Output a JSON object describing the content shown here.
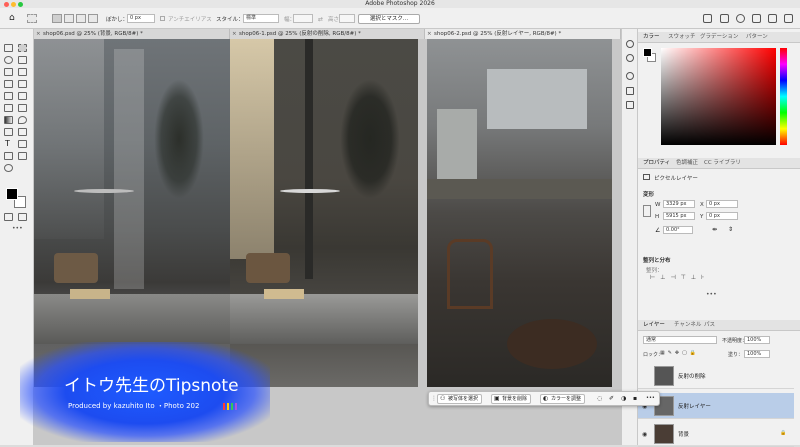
{
  "app": {
    "title": "Adobe Photoshop 2026"
  },
  "options": {
    "feather_label": "ぼかし：",
    "feather_value": "0 px",
    "antialias_label": "アンチエイリアス",
    "style_label": "スタイル：",
    "style_value": "標準",
    "width_label": "幅：",
    "height_label": "高さ：",
    "mask_button": "選択とマスク..."
  },
  "documents": [
    {
      "tab": "shop06.psd @ 25% (背景, RGB/8#) *"
    },
    {
      "tab": "shop06-1.psd @ 25% (反射の削除, RGB/8#) *"
    },
    {
      "tab": "shop06-2.psd @ 25% (反射レイヤー, RGB/8#) *"
    }
  ],
  "color_panel": {
    "tabs": [
      "カラー",
      "スウォッチ",
      "グラデーション",
      "パターン"
    ]
  },
  "properties_panel": {
    "tabs": [
      "プロパティ",
      "色調補正",
      "CC ライブラリ"
    ],
    "layer_type": "ピクセルレイヤー",
    "transform_label": "変形",
    "w_label": "W",
    "w_value": "3329 px",
    "x_label": "X",
    "x_value": "0 px",
    "h_label": "H",
    "h_value": "5915 px",
    "y_label": "Y",
    "y_value": "0 px",
    "angle_value": "0.00°",
    "align_label": "整列と分布",
    "align_sub": "整列："
  },
  "layers_panel": {
    "tabs": [
      "レイヤー",
      "チャンネル",
      "パス"
    ],
    "blend_mode": "通常",
    "opacity_label": "不透明度：",
    "opacity_value": "100%",
    "lock_label": "ロック：",
    "fill_label": "塗り：",
    "fill_value": "100%",
    "layers": [
      {
        "name": "反射の削除",
        "selected": false
      },
      {
        "name": "反射レイヤー",
        "selected": true
      },
      {
        "name": "背景",
        "selected": false
      }
    ]
  },
  "context_bar": {
    "select_subject": "被写体を選択",
    "remove_bg": "背景を削除",
    "adjust_color": "カラーを調整",
    "more": "•••"
  },
  "branding": {
    "title": "イトウ先生のTipsnote",
    "subtitle": "Produced by kazuhito Ito ・Photo 202"
  },
  "colors": {
    "accent_blue": "#1d4cf0",
    "selected_layer": "#b9cde8",
    "foreground": "#000000",
    "background": "#ffffff"
  }
}
